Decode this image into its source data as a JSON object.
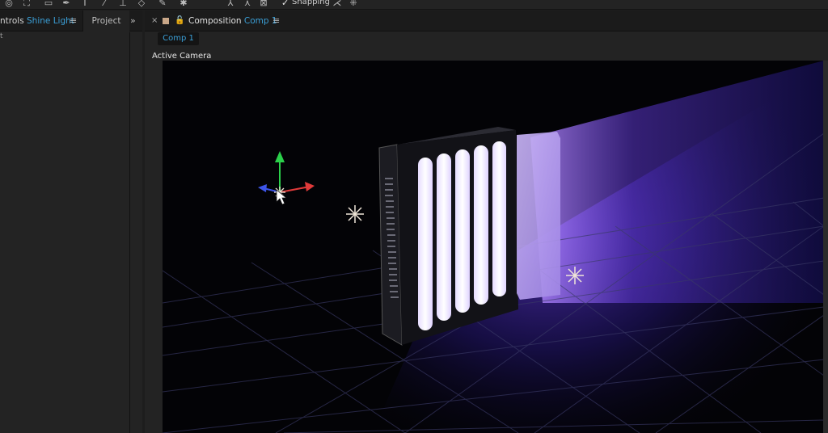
{
  "toolbar": {
    "tools": [
      {
        "name": "orbit-camera-tool-icon",
        "glyph": "◎"
      },
      {
        "name": "pan-behind-tool-icon",
        "glyph": "⛶"
      },
      {
        "name": "rectangle-tool-icon",
        "glyph": "▭"
      },
      {
        "name": "pen-tool-icon",
        "glyph": "✒"
      },
      {
        "name": "type-tool-icon",
        "glyph": "T"
      },
      {
        "name": "brush-tool-icon",
        "glyph": "⁄"
      },
      {
        "name": "clone-stamp-tool-icon",
        "glyph": "⊥"
      },
      {
        "name": "eraser-tool-icon",
        "glyph": "◇"
      },
      {
        "name": "roto-brush-tool-icon",
        "glyph": "✎"
      },
      {
        "name": "puppet-pin-tool-icon",
        "glyph": "✱"
      }
    ],
    "axis_tools": [
      {
        "name": "local-axis-mode-icon",
        "glyph": "⅄"
      },
      {
        "name": "world-axis-mode-icon",
        "glyph": "⋏"
      },
      {
        "name": "view-axis-mode-icon",
        "glyph": "⊠"
      }
    ],
    "snapping_checked": "✓",
    "snapping_label": "Snapping",
    "snapping_icons": [
      {
        "name": "snap-options-icon",
        "glyph": "⋌"
      },
      {
        "name": "snap-grid-icon",
        "glyph": "⁜"
      }
    ]
  },
  "left_panel": {
    "effect_controls_prefix": "ntrols",
    "effect_controls_layer": "Shine Light",
    "menu_glyph": "≡",
    "project_tab": "Project",
    "more_glyph": "»",
    "row_fragment": "t"
  },
  "composition": {
    "close_glyph": "×",
    "lock_glyph": "🔓",
    "label_prefix": "Composition",
    "comp_name": "Comp 1",
    "menu_glyph": "≡",
    "subtab": "Comp 1",
    "view_label": "Active Camera"
  },
  "colors": {
    "accent_blue": "#3ba0d8",
    "light_purple": "#7a4be8",
    "tube_glow": "#f4eefe"
  }
}
